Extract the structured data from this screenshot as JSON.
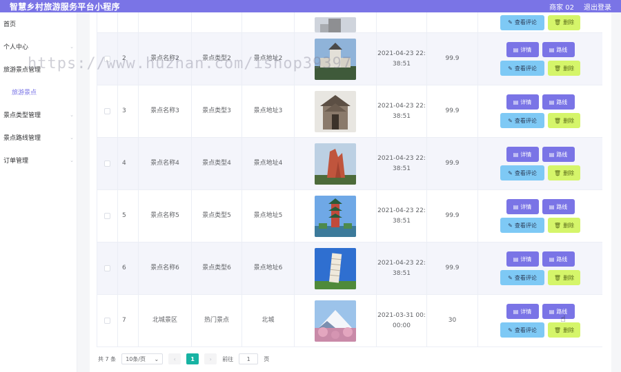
{
  "header": {
    "title": "智慧乡村旅游服务平台小程序",
    "user": "商家 02",
    "logout": "退出登录"
  },
  "sidebar": {
    "items": [
      {
        "label": "首页"
      },
      {
        "label": "个人中心"
      },
      {
        "label": "旅游景点管理"
      },
      {
        "label": "旅游景点"
      },
      {
        "label": "景点类型管理"
      },
      {
        "label": "景点路线管理"
      },
      {
        "label": "订单管理"
      }
    ]
  },
  "actions": {
    "detail": "详情",
    "route": "路线",
    "review": "查看评论",
    "delete": "删除"
  },
  "rows": [
    {
      "idx": "2",
      "name": "景点名称2",
      "type": "景点类型2",
      "addr": "景点地址2",
      "time1": "2021-04-23 22:",
      "time2": "38:51",
      "price": "99.9"
    },
    {
      "idx": "3",
      "name": "景点名称3",
      "type": "景点类型3",
      "addr": "景点地址3",
      "time1": "2021-04-23 22:",
      "time2": "38:51",
      "price": "99.9"
    },
    {
      "idx": "4",
      "name": "景点名称4",
      "type": "景点类型4",
      "addr": "景点地址4",
      "time1": "2021-04-23 22:",
      "time2": "38:51",
      "price": "99.9"
    },
    {
      "idx": "5",
      "name": "景点名称5",
      "type": "景点类型5",
      "addr": "景点地址5",
      "time1": "2021-04-23 22:",
      "time2": "38:51",
      "price": "99.9"
    },
    {
      "idx": "6",
      "name": "景点名称6",
      "type": "景点类型6",
      "addr": "景点地址6",
      "time1": "2021-04-23 22:",
      "time2": "38:51",
      "price": "99.9"
    },
    {
      "idx": "7",
      "name": "北城景区",
      "type": "热门景点",
      "addr": "北城",
      "time1": "2021-03-31 00:",
      "time2": "00:00",
      "price": "30"
    }
  ],
  "pagination": {
    "total": "共 7 条",
    "page_size": "10条/页",
    "current": "1",
    "goto_label": "前往",
    "goto_value": "1",
    "page_unit": "页"
  },
  "watermark": "https://www.huzhan.com/ishop39397",
  "colors": {
    "accent": "#7a74e6",
    "review": "#7ec9f5",
    "delete": "#d5f56a",
    "page_active": "#17b3a3"
  }
}
